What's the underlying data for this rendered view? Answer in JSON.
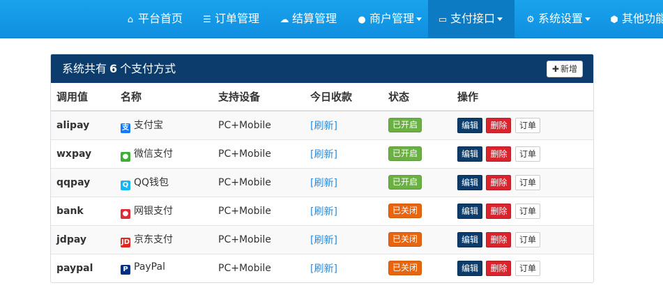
{
  "nav": {
    "items": [
      {
        "label": "平台首页",
        "icon": "home-icon",
        "glyph": "⌂"
      },
      {
        "label": "订单管理",
        "icon": "list-icon",
        "glyph": "☰"
      },
      {
        "label": "结算管理",
        "icon": "cloud-icon",
        "glyph": "☁"
      },
      {
        "label": "商户管理",
        "icon": "user-icon",
        "glyph": "👤",
        "dropdown": true
      },
      {
        "label": "支付接口",
        "icon": "credit-card-icon",
        "glyph": "▭",
        "dropdown": true,
        "active": true
      },
      {
        "label": "系统设置",
        "icon": "gear-icon",
        "glyph": "⚙",
        "dropdown": true
      },
      {
        "label": "其他功能",
        "icon": "cube-icon",
        "glyph": "⬢"
      }
    ]
  },
  "panel": {
    "title_prefix": "系统共有",
    "count": "6",
    "title_suffix": "个支付方式",
    "add_label": "新增"
  },
  "table": {
    "headers": [
      "调用值",
      "名称",
      "支持设备",
      "今日收款",
      "状态",
      "操作"
    ],
    "rows": [
      {
        "code": "alipay",
        "name": "支付宝",
        "icon": "alipay-icon",
        "icon_color": "#1677ff",
        "icon_glyph": "支",
        "device": "PC+Mobile",
        "revenue": "[刷新]",
        "status": "已开启",
        "enabled": true
      },
      {
        "code": "wxpay",
        "name": "微信支付",
        "icon": "wechat-icon",
        "icon_color": "#3cb034",
        "icon_glyph": "●",
        "device": "PC+Mobile",
        "revenue": "[刷新]",
        "status": "已开启",
        "enabled": true
      },
      {
        "code": "qqpay",
        "name": "QQ钱包",
        "icon": "qq-icon",
        "icon_color": "#12b7f5",
        "icon_glyph": "Q",
        "device": "PC+Mobile",
        "revenue": "[刷新]",
        "status": "已开启",
        "enabled": true
      },
      {
        "code": "bank",
        "name": "网银支付",
        "icon": "unionpay-icon",
        "icon_color": "#e02a35",
        "icon_glyph": "●",
        "device": "PC+Mobile",
        "revenue": "[刷新]",
        "status": "已关闭",
        "enabled": false
      },
      {
        "code": "jdpay",
        "name": "京东支付",
        "icon": "jd-icon",
        "icon_color": "#e1251b",
        "icon_glyph": "JD",
        "device": "PC+Mobile",
        "revenue": "[刷新]",
        "status": "已关闭",
        "enabled": false
      },
      {
        "code": "paypal",
        "name": "PayPal",
        "icon": "paypal-icon",
        "icon_color": "#003087",
        "icon_glyph": "P",
        "device": "PC+Mobile",
        "revenue": "[刷新]",
        "status": "已关闭",
        "enabled": false
      }
    ],
    "actions": {
      "edit": "编辑",
      "delete": "删除",
      "order": "订单"
    }
  }
}
